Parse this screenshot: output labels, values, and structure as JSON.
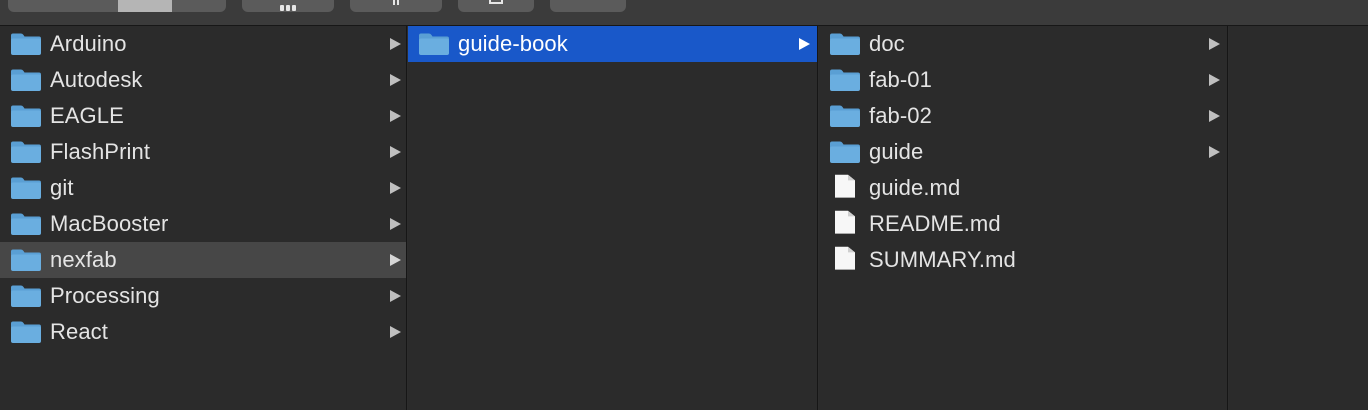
{
  "colors": {
    "background": "#2b2b2b",
    "selection_blue": "#1958c9",
    "selection_gray": "#474747",
    "folder_blue": "#6aaee0",
    "text": "#e4e4e4"
  },
  "toolbar": {
    "segments": [
      {
        "name": "view-icons",
        "icon": "icon-view-icon"
      },
      {
        "name": "view-list",
        "icon": "list-view-icon"
      },
      {
        "name": "view-columns",
        "icon": "column-view-icon",
        "active": true
      },
      {
        "name": "view-gallery",
        "icon": "gallery-view-icon"
      },
      {
        "name": "group",
        "icon": "group-grid-icon"
      },
      {
        "name": "share",
        "icon": "share-icon"
      },
      {
        "name": "tags",
        "icon": "tag-icon"
      },
      {
        "name": "action",
        "icon": "action-menu-icon"
      }
    ]
  },
  "columns": [
    {
      "items": [
        {
          "label": "Arduino",
          "type": "folder",
          "has_children": true
        },
        {
          "label": "Autodesk",
          "type": "folder",
          "has_children": true
        },
        {
          "label": "EAGLE",
          "type": "folder",
          "has_children": true
        },
        {
          "label": "FlashPrint",
          "type": "folder",
          "has_children": true
        },
        {
          "label": "git",
          "type": "folder",
          "has_children": true
        },
        {
          "label": "MacBooster",
          "type": "folder",
          "has_children": true
        },
        {
          "label": "nexfab",
          "type": "folder",
          "has_children": true,
          "selected": "inactive"
        },
        {
          "label": "Processing",
          "type": "folder",
          "has_children": true
        },
        {
          "label": "React",
          "type": "folder",
          "has_children": true
        }
      ]
    },
    {
      "items": [
        {
          "label": "guide-book",
          "type": "folder",
          "has_children": true,
          "selected": "active"
        }
      ]
    },
    {
      "items": [
        {
          "label": "doc",
          "type": "folder",
          "has_children": true
        },
        {
          "label": "fab-01",
          "type": "folder",
          "has_children": true
        },
        {
          "label": "fab-02",
          "type": "folder",
          "has_children": true
        },
        {
          "label": "guide",
          "type": "folder",
          "has_children": true
        },
        {
          "label": "guide.md",
          "type": "file",
          "has_children": false
        },
        {
          "label": "README.md",
          "type": "file",
          "has_children": false
        },
        {
          "label": "SUMMARY.md",
          "type": "file",
          "has_children": false
        }
      ]
    },
    {
      "items": []
    }
  ]
}
